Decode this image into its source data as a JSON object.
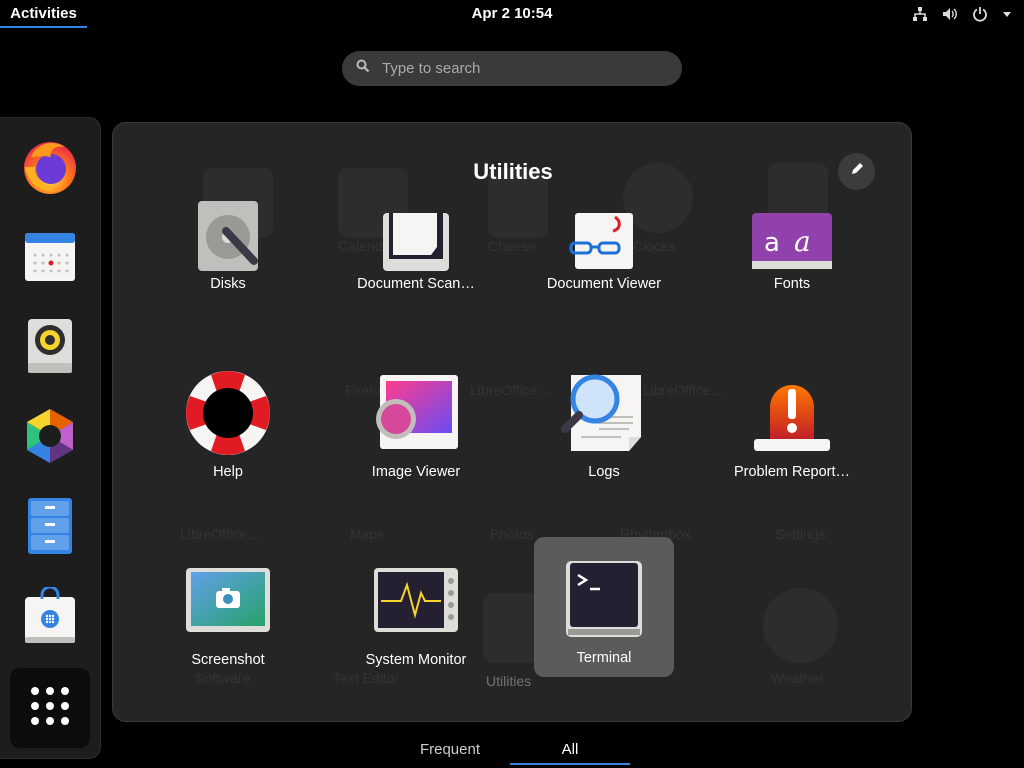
{
  "topbar": {
    "activities_label": "Activities",
    "clock": "Apr 2  10:54",
    "tray_icons": [
      "network-icon",
      "volume-icon",
      "power-icon",
      "chevron-down-icon"
    ]
  },
  "search": {
    "placeholder": "Type to search",
    "value": ""
  },
  "dock": {
    "items": [
      "firefox",
      "calendar",
      "rhythmbox",
      "photos",
      "files",
      "software",
      "show-apps"
    ]
  },
  "folder": {
    "title": "Utilities",
    "apps": [
      {
        "label": "Disks",
        "icon": "disks-icon"
      },
      {
        "label": "Document Scan…",
        "icon": "document-scanner-icon"
      },
      {
        "label": "Document Viewer",
        "icon": "document-viewer-icon"
      },
      {
        "label": "Fonts",
        "icon": "fonts-icon"
      },
      {
        "label": "Help",
        "icon": "help-icon"
      },
      {
        "label": "Image Viewer",
        "icon": "image-viewer-icon"
      },
      {
        "label": "Logs",
        "icon": "logs-icon"
      },
      {
        "label": "Problem Report…",
        "icon": "problem-reporter-icon"
      },
      {
        "label": "Screenshot",
        "icon": "screenshot-icon"
      },
      {
        "label": "System Monitor",
        "icon": "system-monitor-icon"
      },
      {
        "label": "Terminal",
        "icon": "terminal-icon",
        "selected": true
      }
    ],
    "background_labels": [
      "Calendar",
      "Cheese",
      "Clocks",
      "Firefox",
      "LibreOffice…",
      "LibreOffice…",
      "LibreOffice…",
      "Maps",
      "Photos",
      "Rhythmbox",
      "Settings",
      "Software",
      "Text Editor",
      "Utilities",
      "Weather"
    ]
  },
  "tabs": {
    "frequent": "Frequent",
    "all": "All"
  }
}
